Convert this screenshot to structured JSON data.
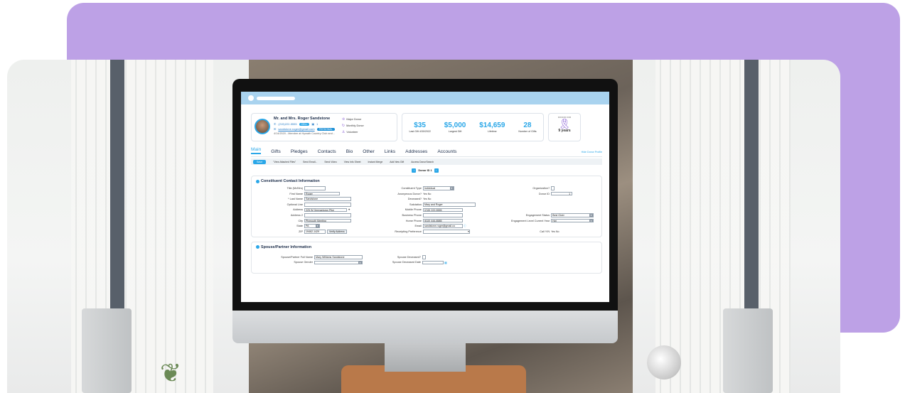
{
  "crm": {
    "profile": {
      "name": "Mr. and Mrs. Roger Sandstone",
      "phone": "(215)222-5555",
      "phone_pill": "CELL",
      "count": "1",
      "email": "sandstone.roger@gmail.com",
      "email_pill": "PERSONAL",
      "meta": "4/14/2020 - Member at Hywath Country Club and..."
    },
    "badges": [
      "Major Donor",
      "Monthly Donor",
      "Volunteer"
    ],
    "stats": [
      {
        "value": "$35",
        "label": "Last Gift 4/30/2022"
      },
      {
        "value": "$5,000",
        "label": "Largest Gift"
      },
      {
        "value": "$14,659",
        "label": "Lifetime"
      },
      {
        "value": "28",
        "label": "Number of Gifts"
      }
    ],
    "donor_for": {
      "title": "DONOR FOR",
      "years": "9 years"
    },
    "tabs": [
      "Main",
      "Gifts",
      "Pledges",
      "Contacts",
      "Bio",
      "Other",
      "Links",
      "Addresses",
      "Accounts"
    ],
    "hide_profile": "Hide Donor Profile",
    "toolbar": {
      "save": "Save",
      "items": [
        "\"View Attached Files\"",
        "Send Email...",
        "Send Video",
        "View Info Sheet",
        "Instant Merge",
        "Add New Gift",
        "Access DonorSearch"
      ]
    },
    "donor_nav": "Donor ID 1",
    "contact": {
      "title": "Constituent Contact Information",
      "left": [
        {
          "label": "Title (Mr/Mrs)",
          "value": ""
        },
        {
          "label": "First Name",
          "value": "Roger"
        },
        {
          "label": "* Last Name",
          "value": "Sandstone"
        },
        {
          "label": "Optional Line",
          "value": ""
        },
        {
          "label": "Address",
          "value": "225 W Germantown Pike"
        },
        {
          "label": "Address 2",
          "value": ""
        },
        {
          "label": "City",
          "value": "Plymouth Meeting"
        },
        {
          "label": "State",
          "value": "PA"
        },
        {
          "label": "ZIP",
          "value": "19462-1429"
        }
      ],
      "verify_address": "Verify Address",
      "middle": [
        {
          "label": "Constituent Type",
          "value": "Individual"
        },
        {
          "label": "Anonymous Donor?",
          "value": "Yes  No"
        },
        {
          "label": "Deceased?",
          "value": "Yes  No"
        },
        {
          "label": "Salutation",
          "value": "Mary and Roger"
        },
        {
          "label": "Mobile Phone",
          "value": "(215) 222-5555"
        },
        {
          "label": "Business Phone",
          "value": ""
        },
        {
          "label": "Home Phone",
          "value": "(610) 444-8585"
        },
        {
          "label": "Email",
          "value": "sandstone.roger@gmail.co"
        },
        {
          "label": "Receipting Preference",
          "value": ""
        }
      ],
      "right": [
        {
          "label": "Organization?",
          "value": ""
        },
        {
          "label": "Donor ID",
          "value": "1"
        },
        {
          "label": "Engagement Status",
          "value": "Best Giver"
        },
        {
          "label": "Engagement Level Current Year",
          "value": "Hot"
        },
        {
          "label": "Call Y/N",
          "value": "Yes  No"
        }
      ]
    },
    "spouse": {
      "title": "Spouse/Partner Information",
      "fields": [
        {
          "label": "Spouse/Partner Full Name",
          "value": "Mary Williams Sandstone"
        },
        {
          "label": "Spouse Gender",
          "value": ""
        },
        {
          "label": "Spouse Deceased?",
          "value": ""
        },
        {
          "label": "Spouse Deceased Date",
          "value": ""
        }
      ]
    }
  }
}
